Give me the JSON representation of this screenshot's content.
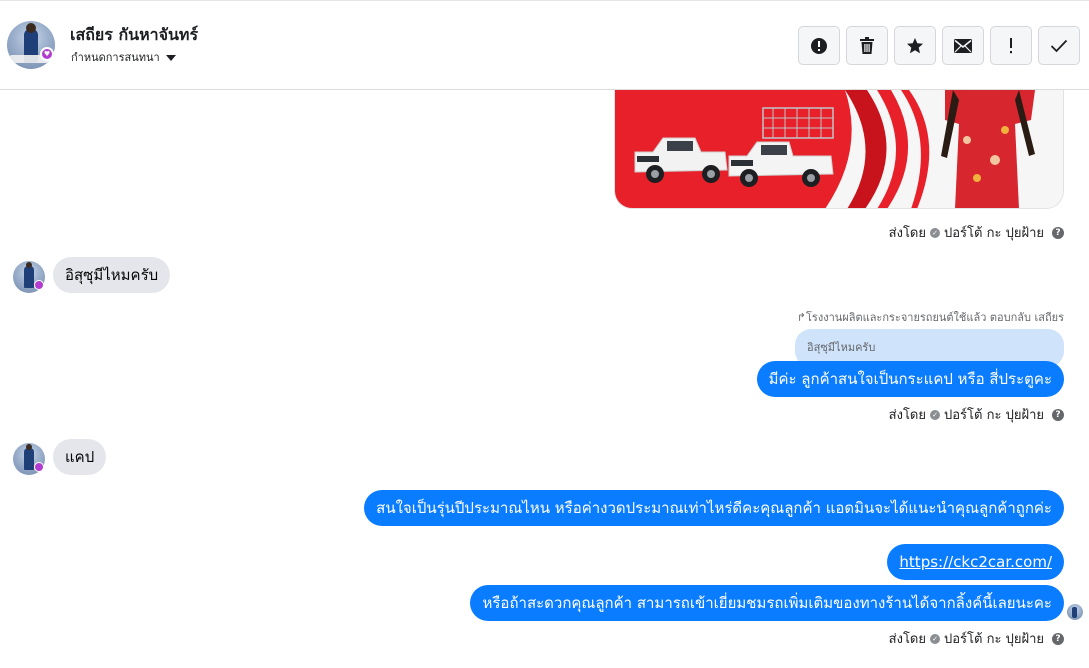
{
  "header": {
    "contact_name": "เสถียร กันหาจันทร์",
    "conversation_label": "กำหนดการสนทนา",
    "toolbar": [
      {
        "name": "report-spam-button",
        "icon": "alert-circle-icon"
      },
      {
        "name": "delete-button",
        "icon": "trash-icon"
      },
      {
        "name": "star-button",
        "icon": "star-icon"
      },
      {
        "name": "mark-unread-button",
        "icon": "envelope-icon"
      },
      {
        "name": "mark-important-button",
        "icon": "exclamation-icon"
      },
      {
        "name": "mark-done-button",
        "icon": "check-icon"
      }
    ]
  },
  "messages": {
    "sent_by_prefix": "ส่งโดย",
    "sender_name": "ปอร์โต้ กะ ปุยฝ้าย",
    "in_1": "อิสุซุมีไหมครับ",
    "reply_note": "โรงงานผลิตและกระจายรถยนต์ใช้แล้ว ตอบกลับ เสถียร",
    "quoted_text": "อิสุซุมีไหมครับ",
    "out_1": "มีค่ะ ลูกค้าสนใจเป็นกระแคป หรือ สี่ประตูคะ",
    "in_2": "แคป",
    "out_2": "สนใจเป็นรุ่นปีประมาณไหน หรือค่างวดประมาณเท่าไหร่ดีคะคุณลูกค้า แอดมินจะได้แนะนำคุณลูกค้าถูกค่ะ",
    "out_3_link": "https://ckc2car.com/",
    "out_4": "หรือถ้าสะดวกคุณลูกค้า สามารถเข้าเยี่ยมชมรถเพิ่มเติมของทางร้านได้จากลิ้งค์นี้เลยนะคะ"
  },
  "colors": {
    "accent": "#0a7cff",
    "incoming_bubble": "#e4e6eb",
    "quoted_bubble": "#cfe3fb",
    "badge": "#b23bd1",
    "banner_red": "#e8202a"
  }
}
